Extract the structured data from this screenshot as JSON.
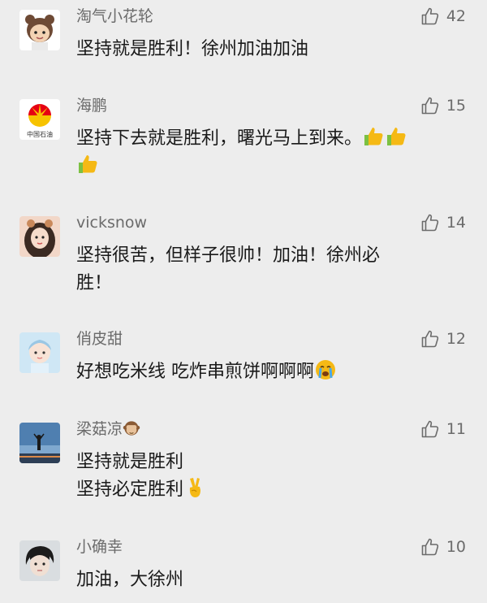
{
  "comments": [
    {
      "user": "淘气小花轮",
      "likes": "42",
      "lines": [
        "坚持就是胜利！徐州加油加油"
      ],
      "avatar_label": ""
    },
    {
      "user": "海鹏",
      "likes": "15",
      "lines": [
        "坚持下去就是胜利，曙光马上到来。",
        ""
      ],
      "avatar_label": "中国石油"
    },
    {
      "user": "vicksnow",
      "likes": "14",
      "lines": [
        "坚持很苦，但样子很帅！加油！徐州必",
        "胜！"
      ],
      "avatar_label": ""
    },
    {
      "user": "俏皮甜",
      "likes": "12",
      "lines": [
        "好想吃米线 吃炸串煎饼啊啊啊"
      ],
      "avatar_label": ""
    },
    {
      "user": "梁菇凉",
      "likes": "11",
      "lines": [
        "坚持就是胜利",
        "坚持必定胜利"
      ],
      "avatar_label": ""
    },
    {
      "user": "小确幸",
      "likes": "10",
      "lines": [
        "加油，大徐州"
      ],
      "avatar_label": ""
    }
  ],
  "colors": {
    "background": "#ededed",
    "name": "#6b6b6b",
    "text": "#1a1a1a",
    "emoji": "#f5b915"
  },
  "icons": {
    "like": "thumbs-up-outline-icon",
    "emojis": [
      "thumbs-up-emoji",
      "crying-face-emoji",
      "see-no-evil-monkey-emoji",
      "victory-hand-emoji"
    ]
  }
}
